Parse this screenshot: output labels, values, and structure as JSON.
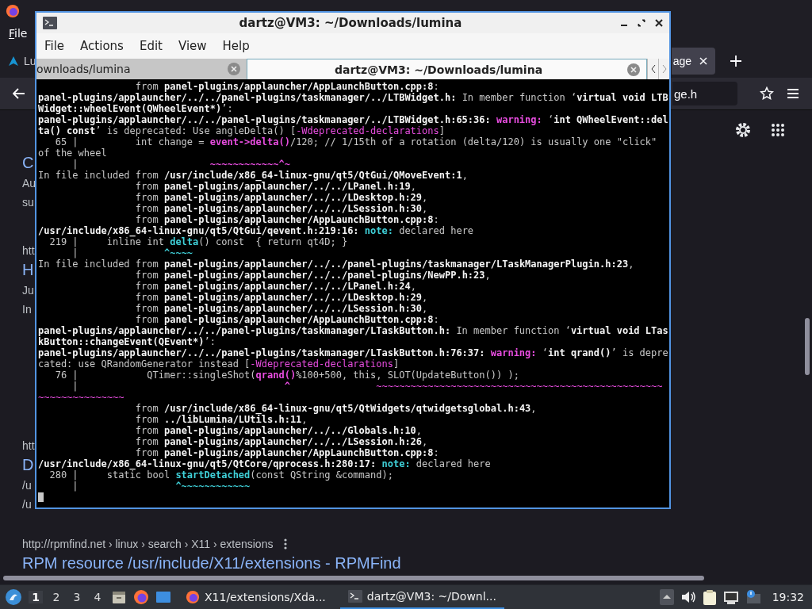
{
  "browser": {
    "menu": [
      "File"
    ],
    "tabs": [
      {
        "label": "Lu",
        "selected": false
      },
      {
        "label": "age",
        "selected": true
      }
    ],
    "url_fragment": "ge.h",
    "results": [
      {
        "title": "C",
        "snippet": [
          "Au",
          "su"
        ]
      },
      {
        "url": "htt",
        "title": "H",
        "snippet": [
          "Ju",
          "In"
        ]
      },
      {
        "url": "htt",
        "title": "D",
        "snippet": [
          "/u",
          "/u"
        ]
      },
      {
        "url": "http://rpmfind.net › linux › search › X11 › extensions",
        "title": "RPM resource /usr/include/X11/extensions - RPMFind"
      }
    ]
  },
  "terminal": {
    "title": "dartz@VM3: ~/Downloads/lumina",
    "menu": [
      "File",
      "Actions",
      "Edit",
      "View",
      "Help"
    ],
    "tabs": [
      {
        "label": "ownloads/lumina",
        "selected": false
      },
      {
        "label": "dartz@VM3: ~/Downloads/lumina",
        "selected": true
      }
    ],
    "lines": [
      [
        {
          "kind": "plain",
          "text": "                 from "
        },
        {
          "kind": "bold",
          "text": "panel-plugins/applauncher/AppLaunchButton.cpp:8"
        },
        {
          "kind": "plain",
          "text": ":"
        }
      ],
      [
        {
          "kind": "bold",
          "text": "panel-plugins/applauncher/../../panel-plugins/taskmanager/../LTBWidget.h:"
        },
        {
          "kind": "plain",
          "text": " In member function ‘"
        },
        {
          "kind": "bold",
          "text": "virtual void LTB"
        }
      ],
      [
        {
          "kind": "bold",
          "text": "Widget::wheelEvent(QWheelEvent*)"
        },
        {
          "kind": "plain",
          "text": "’:"
        }
      ],
      [
        {
          "kind": "bold",
          "text": "panel-plugins/applauncher/../../panel-plugins/taskmanager/../LTBWidget.h:65:36: "
        },
        {
          "kind": "warning",
          "text": "warning:"
        },
        {
          "kind": "plain",
          "text": " ‘"
        },
        {
          "kind": "bold",
          "text": "int QWheelEvent::del"
        }
      ],
      [
        {
          "kind": "bold",
          "text": "ta() const"
        },
        {
          "kind": "plain",
          "text": "’ is deprecated: Use angleDelta() ["
        },
        {
          "kind": "magenta",
          "text": "-Wdeprecated-declarations"
        },
        {
          "kind": "plain",
          "text": "]"
        }
      ],
      [
        {
          "kind": "plain",
          "text": "   65 |          int change = "
        },
        {
          "kind": "warning",
          "text": "event->delta()"
        },
        {
          "kind": "plain",
          "text": "/120; // 1/15th of a rotation (delta/120) is usually one \"click\""
        }
      ],
      [
        {
          "kind": "plain",
          "text": "of the wheel"
        }
      ],
      [
        {
          "kind": "plain",
          "text": "      |                       "
        },
        {
          "kind": "warning",
          "text": "~~~~~~~~~~~~^~"
        }
      ],
      [
        {
          "kind": "plain",
          "text": "In file included from "
        },
        {
          "kind": "bold",
          "text": "/usr/include/x86_64-linux-gnu/qt5/QtGui/QMoveEvent:1"
        },
        {
          "kind": "plain",
          "text": ","
        }
      ],
      [
        {
          "kind": "plain",
          "text": "                 from "
        },
        {
          "kind": "bold",
          "text": "panel-plugins/applauncher/../../LPanel.h:19"
        },
        {
          "kind": "plain",
          "text": ","
        }
      ],
      [
        {
          "kind": "plain",
          "text": "                 from "
        },
        {
          "kind": "bold",
          "text": "panel-plugins/applauncher/../../LDesktop.h:29"
        },
        {
          "kind": "plain",
          "text": ","
        }
      ],
      [
        {
          "kind": "plain",
          "text": "                 from "
        },
        {
          "kind": "bold",
          "text": "panel-plugins/applauncher/../../LSession.h:30"
        },
        {
          "kind": "plain",
          "text": ","
        }
      ],
      [
        {
          "kind": "plain",
          "text": "                 from "
        },
        {
          "kind": "bold",
          "text": "panel-plugins/applauncher/AppLaunchButton.cpp:8"
        },
        {
          "kind": "plain",
          "text": ":"
        }
      ],
      [
        {
          "kind": "bold",
          "text": "/usr/include/x86_64-linux-gnu/qt5/QtGui/qevent.h:219:16: "
        },
        {
          "kind": "note",
          "text": "note:"
        },
        {
          "kind": "plain",
          "text": " declared here"
        }
      ],
      [
        {
          "kind": "plain",
          "text": "  219 |     inline int "
        },
        {
          "kind": "note",
          "text": "delta"
        },
        {
          "kind": "plain",
          "text": "() const  { return qt4D; }"
        }
      ],
      [
        {
          "kind": "plain",
          "text": "      |               "
        },
        {
          "kind": "note",
          "text": "^~~~~"
        }
      ],
      [
        {
          "kind": "plain",
          "text": "In file included from "
        },
        {
          "kind": "bold",
          "text": "panel-plugins/applauncher/../../panel-plugins/taskmanager/LTaskManagerPlugin.h:23"
        },
        {
          "kind": "plain",
          "text": ","
        }
      ],
      [
        {
          "kind": "plain",
          "text": "                 from "
        },
        {
          "kind": "bold",
          "text": "panel-plugins/applauncher/../../panel-plugins/NewPP.h:23"
        },
        {
          "kind": "plain",
          "text": ","
        }
      ],
      [
        {
          "kind": "plain",
          "text": "                 from "
        },
        {
          "kind": "bold",
          "text": "panel-plugins/applauncher/../../LPanel.h:24"
        },
        {
          "kind": "plain",
          "text": ","
        }
      ],
      [
        {
          "kind": "plain",
          "text": "                 from "
        },
        {
          "kind": "bold",
          "text": "panel-plugins/applauncher/../../LDesktop.h:29"
        },
        {
          "kind": "plain",
          "text": ","
        }
      ],
      [
        {
          "kind": "plain",
          "text": "                 from "
        },
        {
          "kind": "bold",
          "text": "panel-plugins/applauncher/../../LSession.h:30"
        },
        {
          "kind": "plain",
          "text": ","
        }
      ],
      [
        {
          "kind": "plain",
          "text": "                 from "
        },
        {
          "kind": "bold",
          "text": "panel-plugins/applauncher/AppLaunchButton.cpp:8"
        },
        {
          "kind": "plain",
          "text": ":"
        }
      ],
      [
        {
          "kind": "bold",
          "text": "panel-plugins/applauncher/../../panel-plugins/taskmanager/LTaskButton.h:"
        },
        {
          "kind": "plain",
          "text": " In member function ‘"
        },
        {
          "kind": "bold",
          "text": "virtual void LTas"
        }
      ],
      [
        {
          "kind": "bold",
          "text": "kButton::changeEvent(QEvent*)"
        },
        {
          "kind": "plain",
          "text": "’:"
        }
      ],
      [
        {
          "kind": "bold",
          "text": "panel-plugins/applauncher/../../panel-plugins/taskmanager/LTaskButton.h:76:37: "
        },
        {
          "kind": "warning",
          "text": "warning:"
        },
        {
          "kind": "plain",
          "text": " ‘"
        },
        {
          "kind": "bold",
          "text": "int qrand()"
        },
        {
          "kind": "plain",
          "text": "’ is depre"
        }
      ],
      [
        {
          "kind": "plain",
          "text": "cated: use QRandomGenerator instead ["
        },
        {
          "kind": "magenta",
          "text": "-Wdeprecated-declarations"
        },
        {
          "kind": "plain",
          "text": "]"
        }
      ],
      [
        {
          "kind": "plain",
          "text": "   76 |            QTimer::singleShot("
        },
        {
          "kind": "warning",
          "text": "qrand()"
        },
        {
          "kind": "plain",
          "text": "%100+500, this, SLOT(UpdateButton()) );"
        }
      ],
      [
        {
          "kind": "plain",
          "text": "      |                                    "
        },
        {
          "kind": "warning",
          "text": "^               "
        },
        {
          "kind": "magenta",
          "text": "~~~~~~~~~~~~~~~~~~~~~~~~~~~~~~~~~~~~~~~~~~~~~~~~~~"
        }
      ],
      [
        {
          "kind": "magenta",
          "text": "~~~~~~~~~~~~~~~"
        }
      ],
      [
        {
          "kind": "plain",
          "text": "                 from "
        },
        {
          "kind": "bold",
          "text": "/usr/include/x86_64-linux-gnu/qt5/QtWidgets/qtwidgetsglobal.h:43"
        },
        {
          "kind": "plain",
          "text": ","
        }
      ],
      [
        {
          "kind": "plain",
          "text": "                 from "
        },
        {
          "kind": "bold",
          "text": "../libLumina/LUtils.h:11"
        },
        {
          "kind": "plain",
          "text": ","
        }
      ],
      [
        {
          "kind": "plain",
          "text": "                 from "
        },
        {
          "kind": "bold",
          "text": "panel-plugins/applauncher/../../Globals.h:10"
        },
        {
          "kind": "plain",
          "text": ","
        }
      ],
      [
        {
          "kind": "plain",
          "text": "                 from "
        },
        {
          "kind": "bold",
          "text": "panel-plugins/applauncher/../../LSession.h:26"
        },
        {
          "kind": "plain",
          "text": ","
        }
      ],
      [
        {
          "kind": "plain",
          "text": "                 from "
        },
        {
          "kind": "bold",
          "text": "panel-plugins/applauncher/AppLaunchButton.cpp:8"
        },
        {
          "kind": "plain",
          "text": ":"
        }
      ],
      [
        {
          "kind": "bold",
          "text": "/usr/include/x86_64-linux-gnu/qt5/QtCore/qprocess.h:280:17: "
        },
        {
          "kind": "note",
          "text": "note:"
        },
        {
          "kind": "plain",
          "text": " declared here"
        }
      ],
      [
        {
          "kind": "plain",
          "text": "  280 |     static bool "
        },
        {
          "kind": "note",
          "text": "startDetached"
        },
        {
          "kind": "plain",
          "text": "(const QString &command);"
        }
      ],
      [
        {
          "kind": "plain",
          "text": "      |                 "
        },
        {
          "kind": "note",
          "text": "^~~~~~~~~~~~~"
        }
      ]
    ]
  },
  "taskbar": {
    "workspaces": [
      {
        "label": "1",
        "selected": true
      },
      {
        "label": "2",
        "selected": false
      },
      {
        "label": "3",
        "selected": false
      },
      {
        "label": "4",
        "selected": false
      }
    ],
    "tasks": [
      {
        "label": "X11/extensions/Xda...",
        "kind": "browser",
        "selected": false
      },
      {
        "label": "dartz@VM3: ~/Downl...",
        "kind": "terminal",
        "selected": true
      }
    ],
    "clock": "19:32"
  }
}
